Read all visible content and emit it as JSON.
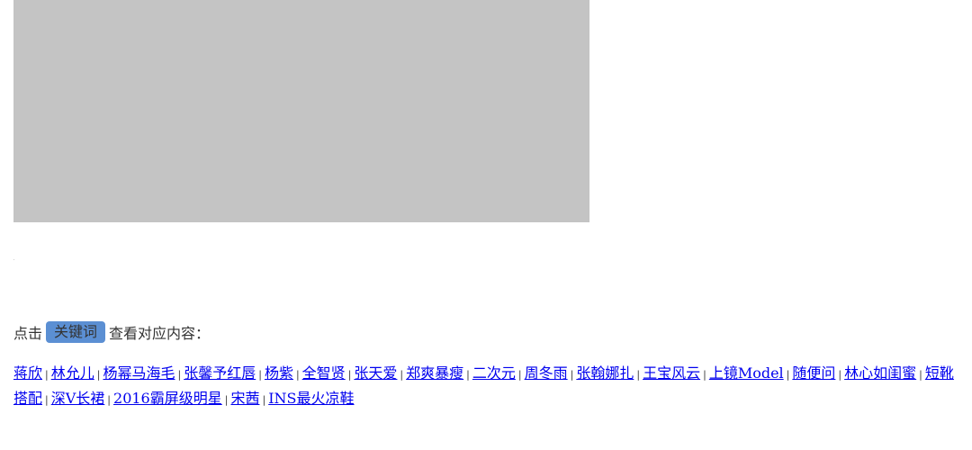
{
  "hint": {
    "prefix": "点击",
    "keyword_badge": "关键词",
    "suffix": "查看对应内容："
  },
  "tags": [
    "蒋欣",
    "林允儿",
    "杨幂马海毛",
    "张馨予红唇",
    "杨紫",
    "全智贤",
    "张天爱",
    "郑爽暴瘦",
    "二次元",
    "周冬雨",
    "张翰娜扎",
    "王宝风云",
    "上镜Model",
    "随便问",
    "林心如闺蜜",
    "短靴搭配",
    "深V长裙",
    "2016霸屏级明星",
    "宋茜",
    "INS最火凉鞋"
  ],
  "separator": "|",
  "colors": {
    "placeholder": "#c4c4c4",
    "badge": "#5b8fd3",
    "link": "#0000ee"
  }
}
